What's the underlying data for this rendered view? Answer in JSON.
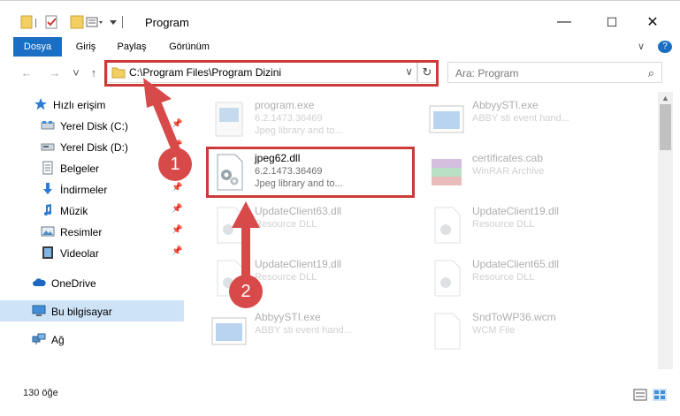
{
  "window": {
    "title": "Program",
    "minimize": "—",
    "maximize": "☐",
    "close": "✕"
  },
  "ribbon": {
    "tabs": [
      {
        "label": "Dosya"
      },
      {
        "label": "Giriş"
      },
      {
        "label": "Paylaş"
      },
      {
        "label": "Görünüm"
      }
    ],
    "collapse_glyph": "∨",
    "help_glyph": "?"
  },
  "nav": {
    "back": "←",
    "forward": "→",
    "recent": "˅",
    "up": "↑",
    "address": "C:\\Program Files\\Program Dizini",
    "address_dropdown": "∨",
    "refresh": "↻",
    "search_placeholder": "Ara: Program",
    "search_glyph": "⌕"
  },
  "sidebar": {
    "items": [
      {
        "label": "Hızlı erişim",
        "pinned": false
      },
      {
        "label": "Yerel Disk (C:)",
        "pinned": true
      },
      {
        "label": "Yerel Disk (D:)",
        "pinned": true
      },
      {
        "label": "Belgeler",
        "pinned": true
      },
      {
        "label": "İndirmeler",
        "pinned": true
      },
      {
        "label": "Müzik",
        "pinned": true
      },
      {
        "label": "Resimler",
        "pinned": true
      },
      {
        "label": "Videolar",
        "pinned": true
      },
      {
        "label": "OneDrive",
        "pinned": false
      },
      {
        "label": "Bu bilgisayar",
        "pinned": false
      },
      {
        "label": "Ağ",
        "pinned": false
      }
    ],
    "pin_glyph": "📌"
  },
  "files": [
    {
      "name": "program.exe",
      "version": "6.2.1473.36469",
      "desc": "Jpeg library and to..."
    },
    {
      "name": "AbbyySTI.exe",
      "version": "ABBY sti event hand...",
      "desc": ""
    },
    {
      "name": "jpeg62.dll",
      "version": "6.2.1473.36469",
      "desc": "Jpeg library and to..."
    },
    {
      "name": "certificates.cab",
      "version": "WinRAR Archive",
      "desc": ""
    },
    {
      "name": "UpdateClient63.dll",
      "version": "Resource DLL",
      "desc": ""
    },
    {
      "name": "UpdateClient19.dll",
      "version": "Resource DLL",
      "desc": ""
    },
    {
      "name": "UpdateClient19.dll",
      "version": "Resource DLL",
      "desc": ""
    },
    {
      "name": "UpdateClient65.dll",
      "version": "Resource DLL",
      "desc": ""
    },
    {
      "name": "AbbyySTI.exe",
      "version": "ABBY sti event hand...",
      "desc": ""
    },
    {
      "name": "SndToWP36.wcm",
      "version": "WCM File",
      "desc": ""
    }
  ],
  "status": {
    "count": "130 öğe"
  },
  "annotations": {
    "step1": "1",
    "step2": "2",
    "color": "#d84a4a"
  }
}
